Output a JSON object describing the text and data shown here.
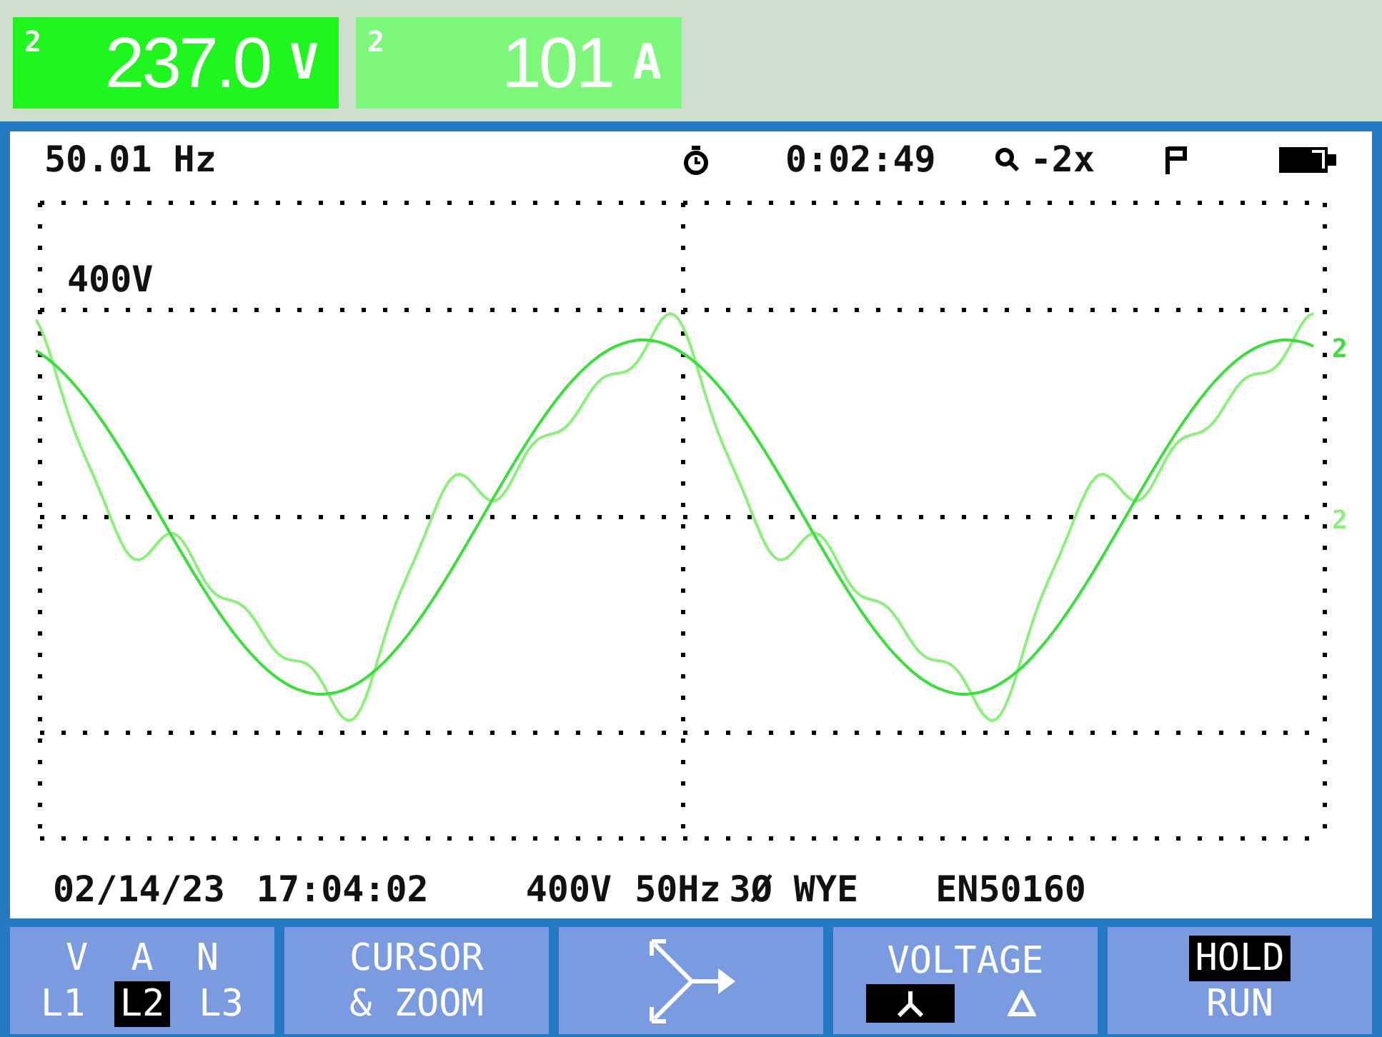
{
  "readouts": [
    {
      "phase": "2",
      "value": "237.0",
      "unit": "V",
      "selected": true
    },
    {
      "phase": "2",
      "value": "101",
      "unit": "A",
      "selected": false
    }
  ],
  "status": {
    "frequency": "50.01 Hz",
    "timer": "0:02:49",
    "zoom": "-2x"
  },
  "scope": {
    "scale": "400V",
    "trace_labels": [
      "2",
      "2"
    ]
  },
  "footer": [
    "02/14/23",
    "17:04:02",
    "400V",
    "50Hz",
    "3Ø WYE",
    "EN50160"
  ],
  "softkeys": [
    {
      "kind": "phases",
      "top": [
        "V",
        "A",
        "N"
      ],
      "options": [
        {
          "label": "L1",
          "selected": false
        },
        {
          "label": "L2",
          "selected": true
        },
        {
          "label": "L3",
          "selected": false
        }
      ]
    },
    {
      "kind": "text",
      "lines": [
        "CURSOR",
        "& ZOOM"
      ]
    },
    {
      "kind": "icon"
    },
    {
      "kind": "wiring",
      "title": "VOLTAGE",
      "options": [
        {
          "kind": "wye",
          "selected": true
        },
        {
          "kind": "delta",
          "selected": false
        }
      ]
    },
    {
      "kind": "toggle",
      "options": [
        {
          "label": "HOLD",
          "selected": true
        },
        {
          "label": "RUN",
          "selected": false
        }
      ]
    }
  ]
}
